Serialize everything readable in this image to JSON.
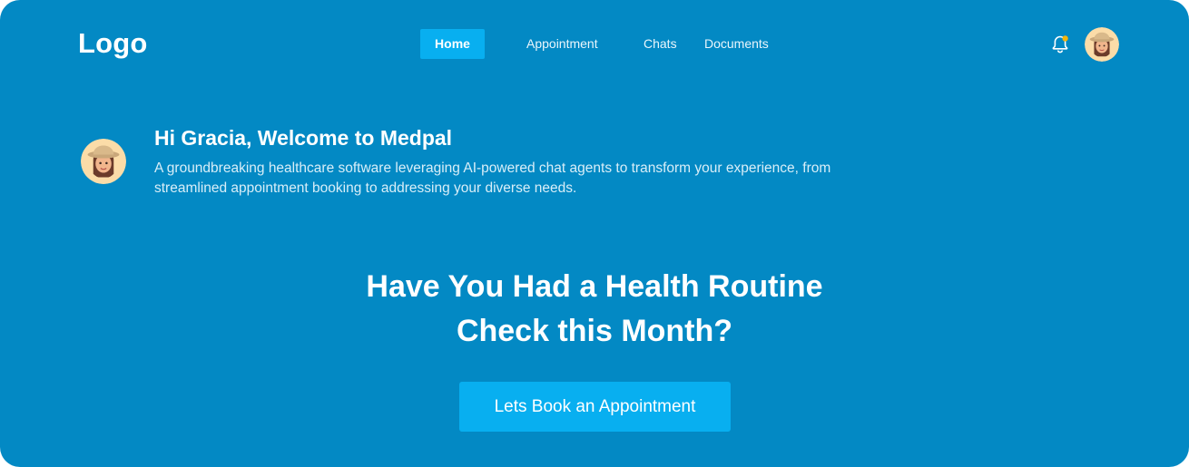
{
  "header": {
    "logo": "Logo",
    "nav": [
      {
        "label": "Home",
        "active": true
      },
      {
        "label": "Appointment",
        "active": false
      },
      {
        "label": "Chats",
        "active": false
      },
      {
        "label": "Documents",
        "active": false
      }
    ],
    "notification_icon": "bell-icon",
    "notification_dot_color": "#f5b50a"
  },
  "welcome": {
    "title": "Hi Gracia, Welcome to Medpal",
    "description": "A groundbreaking healthcare software leveraging AI-powered chat agents to transform your experience, from streamlined appointment booking to addressing your diverse needs."
  },
  "hero": {
    "headline_line1": "Have You Had a Health Routine",
    "headline_line2": "Check this Month?",
    "cta_label": "Lets Book an Appointment"
  },
  "colors": {
    "background": "#0389c4",
    "accent": "#08aff0",
    "text": "#ffffff"
  }
}
